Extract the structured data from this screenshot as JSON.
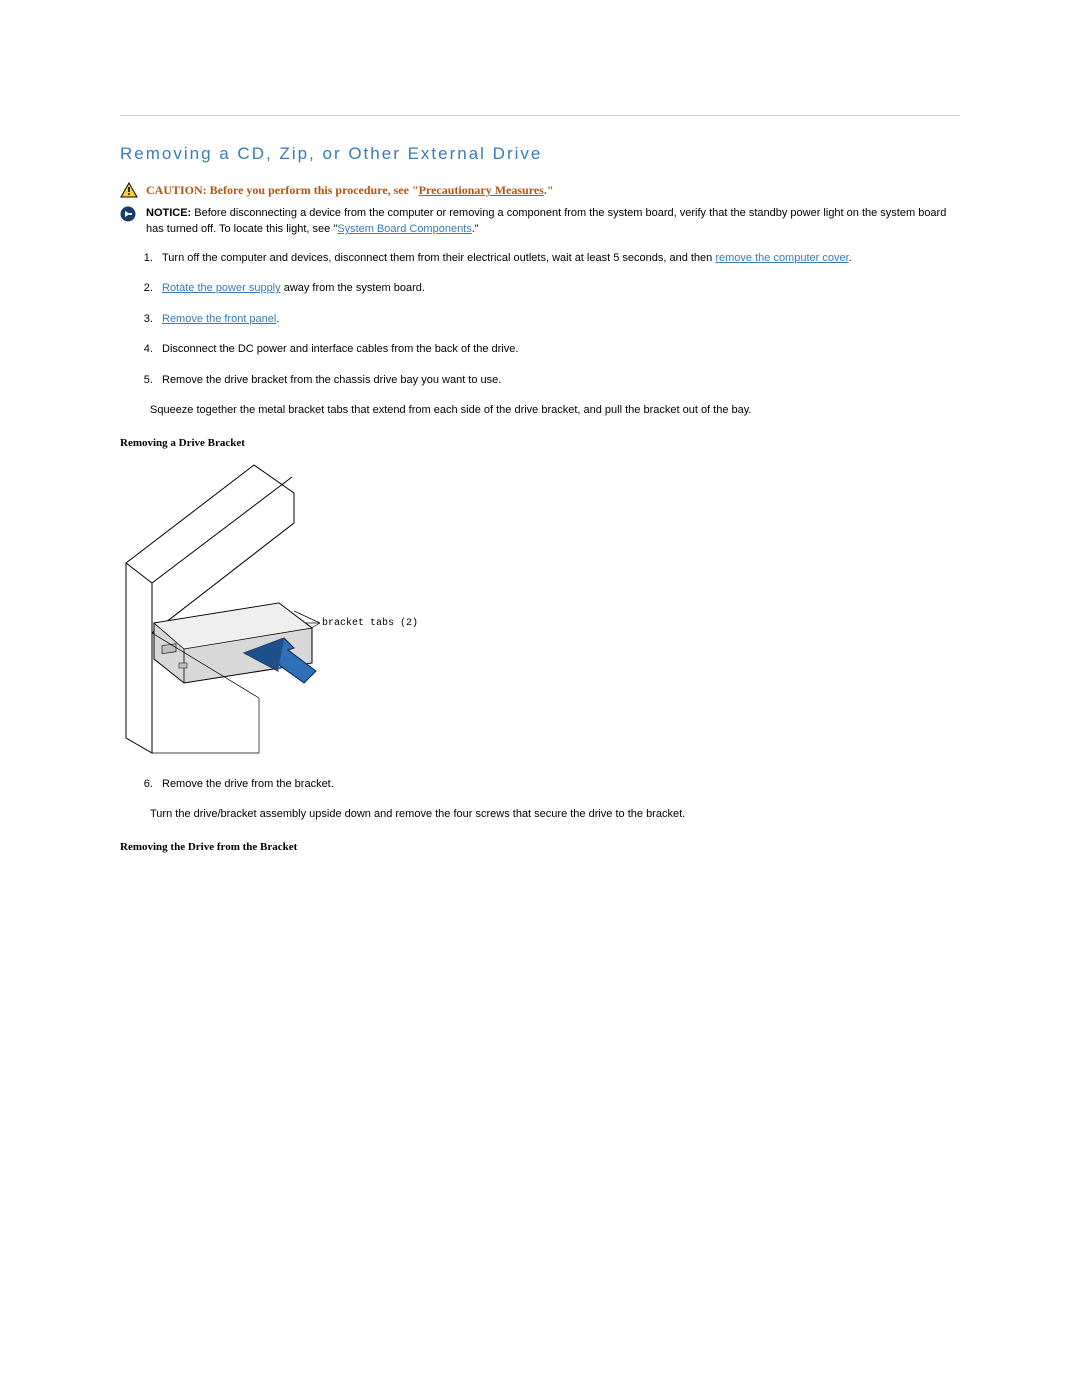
{
  "section_title": "Removing a CD, Zip, or Other External Drive",
  "alerts": {
    "caution": {
      "prefix": "CAUTION: Before you perform this procedure, see \"",
      "link_text": "Precautionary Measures",
      "suffix": ".\""
    },
    "notice": {
      "label": "NOTICE: ",
      "text_before": "Before disconnecting a device from the computer or removing a component from the system board, verify that the standby power light on the system board has turned off. To locate this light, see \"",
      "link_text": "System Board Components",
      "text_after": ".\""
    }
  },
  "steps": {
    "s1_before": "Turn off the computer and devices, disconnect them from their electrical outlets, wait at least 5 seconds, and then ",
    "s1_link": "remove the computer cover",
    "s1_after": ".",
    "s2_link": "Rotate the power supply",
    "s2_after": " away from the system board.",
    "s3_link": "Remove the front panel",
    "s3_after": ".",
    "s4": "Disconnect the DC power and interface cables from the back of the drive.",
    "s5": "Remove the drive bracket from the chassis drive bay you want to use.",
    "s5_para": "Squeeze together the metal bracket tabs that extend from each side of the drive bracket, and pull the bracket out of the bay.",
    "s6": "Remove the drive from the bracket.",
    "s6_para": "Turn the drive/bracket assembly upside down and remove the four screws that secure the drive to the bracket."
  },
  "figures": {
    "fig1_caption": "Removing a Drive Bracket",
    "fig1_label": "bracket tabs (2)",
    "fig2_caption": "Removing the Drive from the Bracket"
  }
}
